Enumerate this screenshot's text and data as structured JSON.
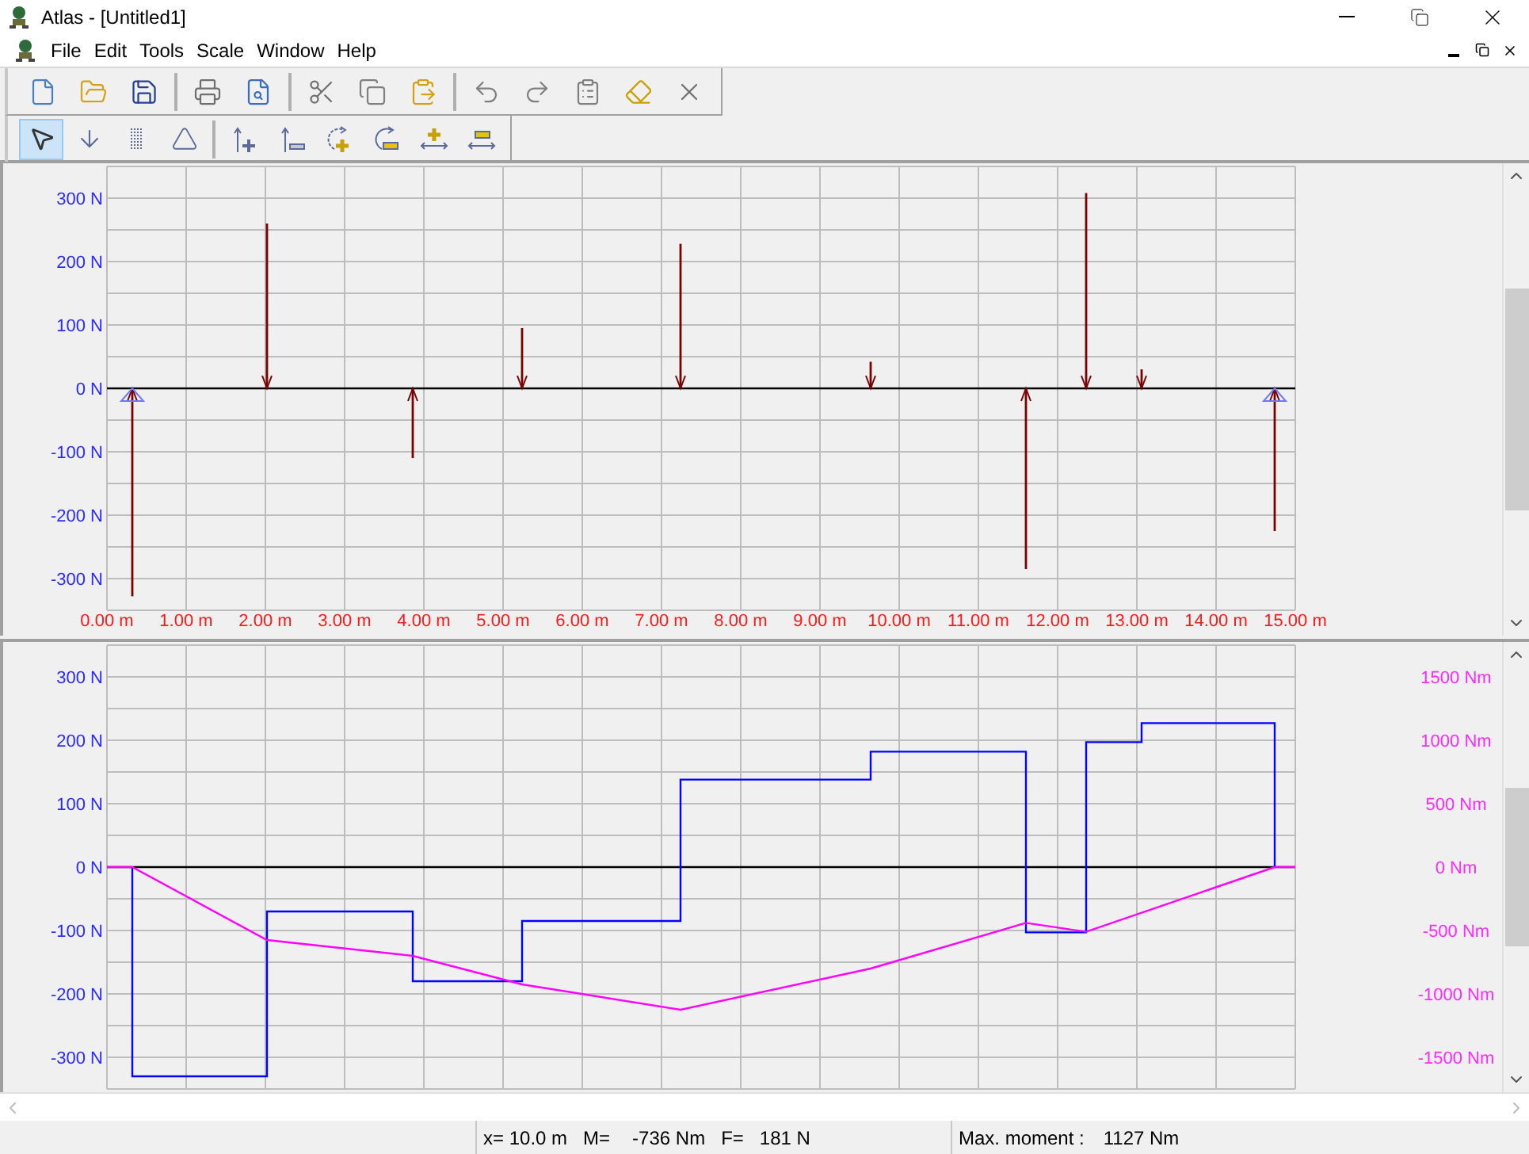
{
  "window": {
    "title": "Atlas - [Untitled1]"
  },
  "menu": [
    {
      "label": "File"
    },
    {
      "label": "Edit"
    },
    {
      "label": "Tools"
    },
    {
      "label": "Scale"
    },
    {
      "label": "Window"
    },
    {
      "label": "Help"
    }
  ],
  "toolbar_groups": [
    [
      {
        "kind": "new"
      },
      {
        "kind": "open"
      },
      {
        "kind": "save"
      }
    ],
    [
      {
        "kind": "print"
      },
      {
        "kind": "preview"
      }
    ],
    [
      {
        "kind": "cut"
      },
      {
        "kind": "copy"
      },
      {
        "kind": "paste"
      }
    ],
    [
      {
        "kind": "undo"
      },
      {
        "kind": "redo"
      },
      {
        "kind": "properties"
      },
      {
        "kind": "erase"
      },
      {
        "kind": "delete"
      }
    ]
  ],
  "tool_groups": [
    [
      {
        "kind": "pointer",
        "selected": true
      },
      {
        "kind": "point-load",
        "selected": false
      },
      {
        "kind": "wall",
        "selected": false
      },
      {
        "kind": "support",
        "selected": false
      }
    ],
    [
      {
        "kind": "force-add",
        "selected": false
      },
      {
        "kind": "force-remove",
        "selected": false
      },
      {
        "kind": "moment-add",
        "selected": false
      },
      {
        "kind": "moment-remove",
        "selected": false
      },
      {
        "kind": "span-add",
        "selected": false
      },
      {
        "kind": "span-remove",
        "selected": false
      }
    ]
  ],
  "load_pane": {
    "chart_data": {
      "type": "bar",
      "grid": true,
      "x": [
        0.32,
        2.02,
        3.86,
        5.24,
        7.24,
        9.64,
        11.6,
        12.36,
        13.06,
        14.74
      ],
      "values": [
        -328,
        260,
        -110,
        95,
        228,
        42,
        -285,
        308,
        30,
        -225
      ],
      "xlim": [
        0,
        15
      ],
      "ylim": [
        -350,
        350
      ],
      "xticks": [
        {
          "value": 0,
          "label": "0.00 m"
        },
        {
          "value": 1,
          "label": "1.00 m"
        },
        {
          "value": 2,
          "label": "2.00 m"
        },
        {
          "value": 3,
          "label": "3.00 m"
        },
        {
          "value": 4,
          "label": "4.00 m"
        },
        {
          "value": 5,
          "label": "5.00 m"
        },
        {
          "value": 6,
          "label": "6.00 m"
        },
        {
          "value": 7,
          "label": "7.00 m"
        },
        {
          "value": 8,
          "label": "8.00 m"
        },
        {
          "value": 9,
          "label": "9.00 m"
        },
        {
          "value": 10,
          "label": "10.00 m"
        },
        {
          "value": 11,
          "label": "11.00 m"
        },
        {
          "value": 12,
          "label": "12.00 m"
        },
        {
          "value": 13,
          "label": "13.00 m"
        },
        {
          "value": 14,
          "label": "14.00 m"
        },
        {
          "value": 15,
          "label": "15.00 m"
        }
      ],
      "yticks": [
        {
          "value": 300,
          "label": "300 N"
        },
        {
          "value": 200,
          "label": "200 N"
        },
        {
          "value": 100,
          "label": "100 N"
        },
        {
          "value": 0,
          "label": "0 N"
        },
        {
          "value": -100,
          "label": "-100 N"
        },
        {
          "value": -200,
          "label": "-200 N"
        },
        {
          "value": -300,
          "label": "-300 N"
        }
      ]
    }
  },
  "diagram_pane": {
    "chart_data": {
      "type": "line",
      "grid": true,
      "xlim": [
        0,
        15
      ],
      "ylim": [
        -350,
        350
      ],
      "y2lim": [
        -1750,
        1750
      ],
      "series": [
        {
          "color": "#0000ff",
          "x": [
            0.32,
            0.32,
            2.02,
            2.02,
            3.86,
            3.86,
            5.24,
            5.24,
            7.24,
            7.24,
            9.64,
            9.64,
            11.6,
            11.6,
            12.36,
            12.36,
            13.06,
            13.06,
            14.74,
            14.74
          ],
          "values": [
            0,
            -330,
            -330,
            -70,
            -70,
            -180,
            -180,
            -85,
            -85,
            138,
            138,
            182,
            182,
            -103,
            -103,
            197,
            197,
            227,
            227,
            0
          ]
        },
        {
          "color": "#ff00ff",
          "axis": "y2",
          "x": [
            0,
            0.32,
            2.02,
            3.86,
            5.24,
            7.24,
            9.64,
            11.6,
            12.36,
            14.74,
            15
          ],
          "values": [
            0,
            0,
            -575,
            -700,
            -925,
            -1125,
            -800,
            -440,
            -510,
            0,
            0
          ]
        }
      ],
      "yticks": [
        {
          "value": 300,
          "label": "300 N"
        },
        {
          "value": 200,
          "label": "200 N"
        },
        {
          "value": 100,
          "label": "100 N"
        },
        {
          "value": 0,
          "label": "0 N"
        },
        {
          "value": -100,
          "label": "-100 N"
        },
        {
          "value": -200,
          "label": "-200 N"
        },
        {
          "value": -300,
          "label": "-300 N"
        }
      ],
      "y2ticks": [
        {
          "value": 1500,
          "label": "1500 Nm"
        },
        {
          "value": 1000,
          "label": "1000 Nm"
        },
        {
          "value": 500,
          "label": "500 Nm"
        },
        {
          "value": 0,
          "label": "0 Nm"
        },
        {
          "value": -500,
          "label": "-500 Nm"
        },
        {
          "value": -1000,
          "label": "-1000 Nm"
        },
        {
          "value": -1500,
          "label": "-1500 Nm"
        }
      ]
    }
  },
  "status_bar": {
    "position": "x= 10.0 m",
    "moment_label": "M=",
    "moment": "-736 Nm",
    "force_label": "F=",
    "force": "181 N",
    "max_label": "Max. moment :",
    "max_moment": "1127 Nm"
  }
}
